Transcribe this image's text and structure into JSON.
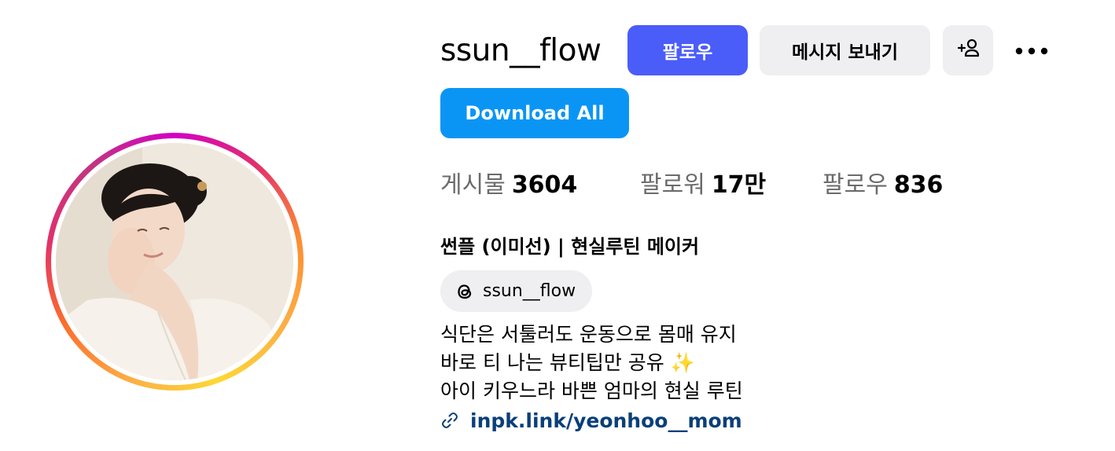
{
  "profile": {
    "username": "ssun__flow",
    "display_name": "썬플 (이미선) | 현실루틴 메이커",
    "avatar_alt": "profile-photo"
  },
  "actions": {
    "follow_label": "팔로우",
    "message_label": "메시지 보내기",
    "add_user_icon": "add-user-icon",
    "more_icon": "more-options-icon",
    "download_all_label": "Download All"
  },
  "stats": {
    "posts_label": "게시물",
    "posts_value": "3604",
    "followers_label": "팔로워",
    "followers_value": "17만",
    "following_label": "팔로우",
    "following_value": "836"
  },
  "threads": {
    "icon": "threads-icon",
    "handle": "ssun__flow"
  },
  "bio": {
    "line1": "식단은 서툴러도 운동으로 몸매 유지",
    "line2": "바로 티 나는 뷰티팁만 공유 ✨",
    "line3": "아이 키우느라 바쁜 엄마의 현실 루틴"
  },
  "link": {
    "icon": "link-icon",
    "text": "inpk.link/yeonhoo__mom"
  },
  "colors": {
    "follow_button": "#4a5df9",
    "download_button": "#0a95f5",
    "secondary_button": "#efeff1",
    "link_text": "#0a3f7a",
    "stat_label": "#6b6b6b"
  }
}
